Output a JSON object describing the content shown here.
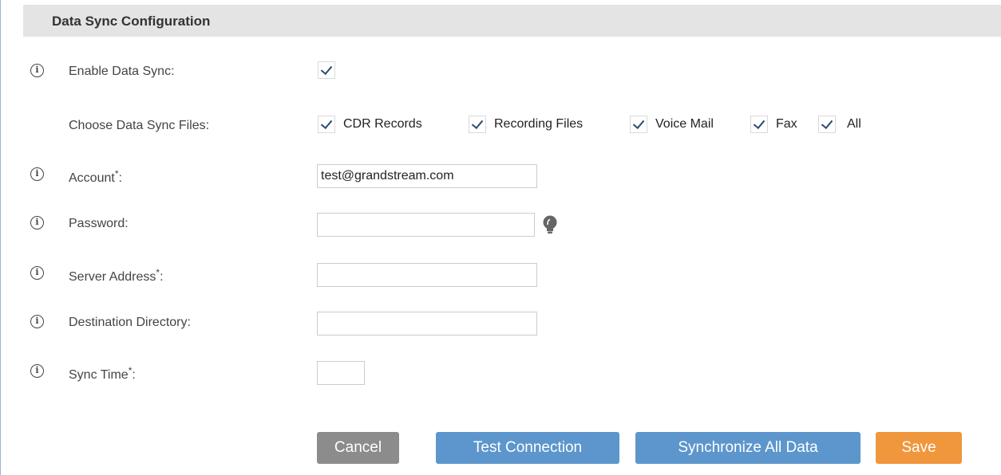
{
  "header": {
    "title": "Data Sync Configuration"
  },
  "fields": {
    "enable_data_sync": {
      "label": "Enable Data Sync:",
      "checked": true
    },
    "choose_files": {
      "label": "Choose Data Sync Files:",
      "options": [
        {
          "label": "CDR Records",
          "checked": true
        },
        {
          "label": "Recording Files",
          "checked": true
        },
        {
          "label": "Voice Mail",
          "checked": true
        },
        {
          "label": "Fax",
          "checked": true
        },
        {
          "label": "All",
          "checked": true
        }
      ]
    },
    "account": {
      "label": "Account",
      "required_mark": "*",
      "suffix": ":",
      "value": "test@grandstream.com"
    },
    "password": {
      "label": "Password:",
      "value": ""
    },
    "server_address": {
      "label": "Server Address",
      "required_mark": "*",
      "suffix": ":",
      "value": ""
    },
    "destination_directory": {
      "label": "Destination Directory:",
      "value": ""
    },
    "sync_time": {
      "label": "Sync Time",
      "required_mark": "*",
      "suffix": ":",
      "value": ""
    }
  },
  "icons": {
    "info": "info-circle-icon",
    "password_hint": "lightbulb-icon"
  },
  "buttons": {
    "cancel": "Cancel",
    "test_connection": "Test Connection",
    "synchronize_all": "Synchronize All Data",
    "save": "Save"
  },
  "colors": {
    "cancel_button": "#8c8c8c",
    "primary_button": "#5c96cc",
    "save_button": "#f0963c",
    "header_bg": "#e4e4e4"
  }
}
